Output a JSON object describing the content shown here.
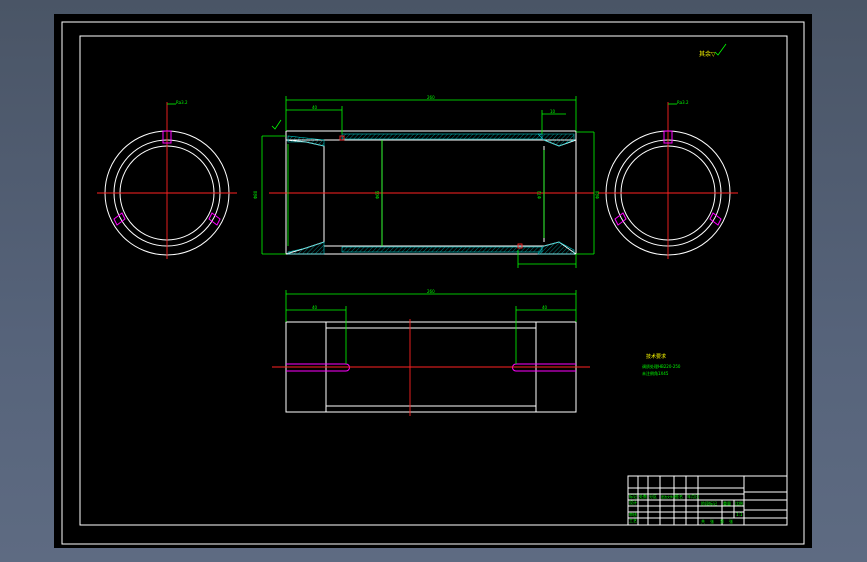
{
  "drawing": {
    "roughness_note": "其余▽",
    "tech_req_title": "技术要求",
    "tech_req_lines": [
      "调质处理HB220-250",
      "未注倒角1X45"
    ],
    "dims": {
      "overall_length": "260",
      "left_offset": "40",
      "right_offset": "10",
      "od_left": "Φ80",
      "id_mid": "Φ65",
      "bore_right": "Φ72",
      "od_right": "Φ80",
      "bottom_length": "260",
      "bottom_left": "40",
      "bottom_right": "40",
      "ring_mark": "Ra3.2"
    },
    "title_block": {
      "col_labels": [
        "标记",
        "处数",
        "分区",
        "更改文件号",
        "签名",
        "年月日"
      ],
      "row_labels": [
        "设计",
        "审核",
        "工艺"
      ],
      "stage_labels": [
        "阶段标记",
        "重量",
        "比例"
      ],
      "scale": "1:1",
      "sheet": [
        "共",
        "张",
        "第",
        "张"
      ]
    }
  },
  "colors": {
    "outline": "#ffffff",
    "dimension": "#00ff00",
    "centerline": "#ff2222",
    "thread": "#ff00ff",
    "hatch": "#00cccc"
  }
}
